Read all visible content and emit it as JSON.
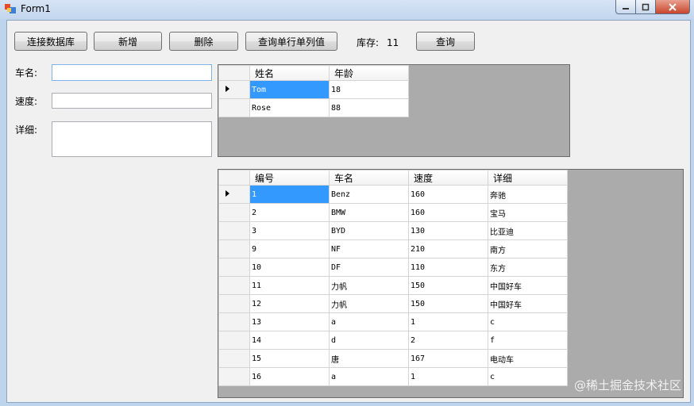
{
  "window": {
    "title": "Form1"
  },
  "toolbar": {
    "connect_label": "连接数据库",
    "add_label": "新增",
    "delete_label": "删除",
    "query_single_label": "查询单行单列值",
    "stock_label": "库存:",
    "stock_value": "11",
    "query_label": "查询"
  },
  "form": {
    "car_name_label": "车名:",
    "speed_label": "速度:",
    "detail_label": "详细:",
    "car_name_value": "",
    "speed_value": "",
    "detail_value": ""
  },
  "people_grid": {
    "columns": [
      "姓名",
      "年龄"
    ],
    "rows": [
      [
        "Tom",
        "18"
      ],
      [
        "Rose",
        "88"
      ]
    ]
  },
  "car_grid": {
    "columns": [
      "编号",
      "车名",
      "速度",
      "详细"
    ],
    "rows": [
      [
        "1",
        "Benz",
        "160",
        "奔驰"
      ],
      [
        "2",
        "BMW",
        "160",
        "宝马"
      ],
      [
        "3",
        "BYD",
        "130",
        "比亚迪"
      ],
      [
        "9",
        "NF",
        "210",
        "南方"
      ],
      [
        "10",
        "DF",
        "110",
        "东方"
      ],
      [
        "11",
        "力帆",
        "150",
        "中国好车"
      ],
      [
        "12",
        "力帆",
        "150",
        "中国好车"
      ],
      [
        "13",
        "a",
        "1",
        "c"
      ],
      [
        "14",
        "d",
        "2",
        "f"
      ],
      [
        "15",
        "唐",
        "167",
        "电动车"
      ],
      [
        "16",
        "a",
        "1",
        "c"
      ]
    ]
  },
  "watermark": "@稀土掘金技术社区",
  "colors": {
    "selection": "#3399ff",
    "grid_bg": "#ababab"
  }
}
